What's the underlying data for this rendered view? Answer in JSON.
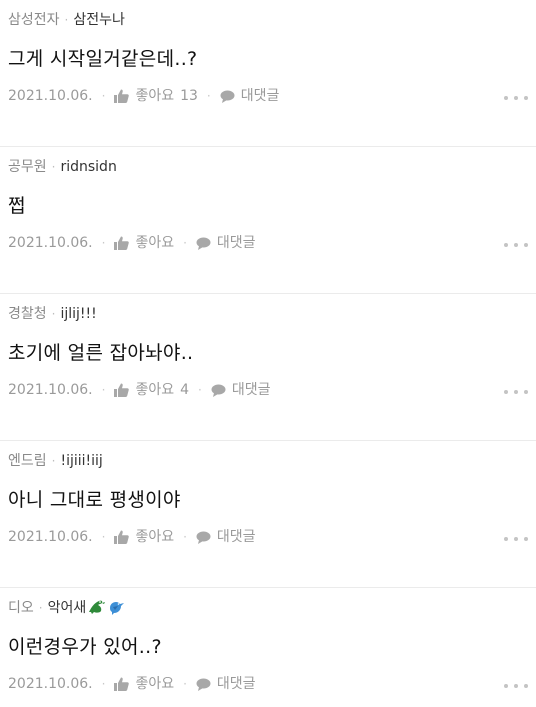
{
  "comments": [
    {
      "company": "삼성전자",
      "nickname": "삼전누나",
      "text": "그게 시작일거같은데..?",
      "date": "2021.10.06.",
      "like_label": "좋아요",
      "like_count": "13",
      "reply_label": "대댓글"
    },
    {
      "company": "공무원",
      "nickname": "ridnsidn",
      "text": "쩝",
      "date": "2021.10.06.",
      "like_label": "좋아요",
      "like_count": "",
      "reply_label": "대댓글"
    },
    {
      "company": "경찰청",
      "nickname": "ijlij!!!",
      "text": "초기에 얼른 잡아놔야..",
      "date": "2021.10.06.",
      "like_label": "좋아요",
      "like_count": "4",
      "reply_label": "대댓글"
    },
    {
      "company": "엔드림",
      "nickname": "!ijiii!iij",
      "text": "아니 그대로 평생이야",
      "date": "2021.10.06.",
      "like_label": "좋아요",
      "like_count": "",
      "reply_label": "대댓글"
    },
    {
      "company": "디오",
      "nickname": "악어새",
      "nickname_icons": [
        "crocodile-icon",
        "bird-icon"
      ],
      "text": "이런경우가 있어..?",
      "date": "2021.10.06.",
      "like_label": "좋아요",
      "like_count": "",
      "reply_label": "대댓글"
    }
  ],
  "separator": "·",
  "icons": {
    "like": "thumbs-up-icon",
    "reply": "speech-bubble-icon",
    "more": "more-dots-icon"
  },
  "colors": {
    "text": "#111111",
    "muted": "#9a9a9a",
    "company": "#8a8a8a",
    "divider": "#ebebeb",
    "crocodile": "#2f8a3a",
    "bird": "#3d8fd6"
  }
}
